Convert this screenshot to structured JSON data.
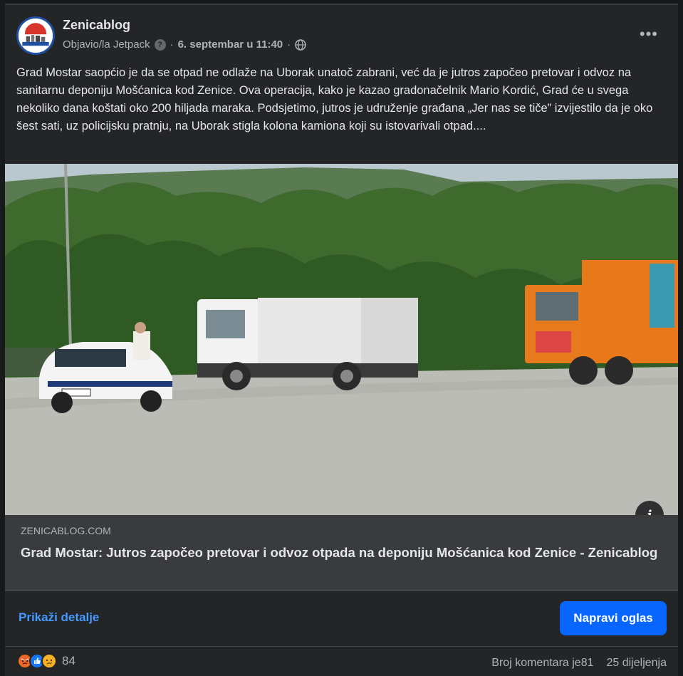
{
  "post": {
    "page_name": "Zenicablog",
    "published_by": "Objavio/la Jetpack",
    "separator": "·",
    "date": "6. septembar u 11:40",
    "more_label": "•••",
    "body": "Grad Mostar saopćio je da se otpad ne odlaže na Uborak unatoč zabrani, već da je jutros započeo pretovar i odvoz na sanitarnu deponiju Mošćanica kod Zenice. Ova operacija, kako je kazao gradonačelnik Mario Kordić, Grad će u svega nekoliko dana koštati oko 200 hiljada maraka. Podsjetimo, jutros je udruženje građana „Jer nas se tiče” izvijestilo da je oko šest sati, uz policijsku pratnju, na Uborak stigla kolona kamiona koji su istovarivali otpad...."
  },
  "link": {
    "domain": "ZENICABLOG.COM",
    "title": "Grad Mostar: Jutros započeo pretovar i odvoz otpada na deponiju Mošćanica kod Zenice - Zenicablog",
    "info_label": "i"
  },
  "actions": {
    "details_label": "Prikaži detalje",
    "ad_button_label": "Napravi oglas"
  },
  "footer": {
    "reaction_icons": [
      "angry-icon",
      "like-icon",
      "sad-icon"
    ],
    "reaction_count": "84",
    "comments": "Broj komentara je81",
    "shares": "25 dijeljenja"
  },
  "colors": {
    "background": "#242526",
    "link_box": "#3a3b3c",
    "accent_blue": "#0866ff",
    "link_text_blue": "#4599ff"
  }
}
